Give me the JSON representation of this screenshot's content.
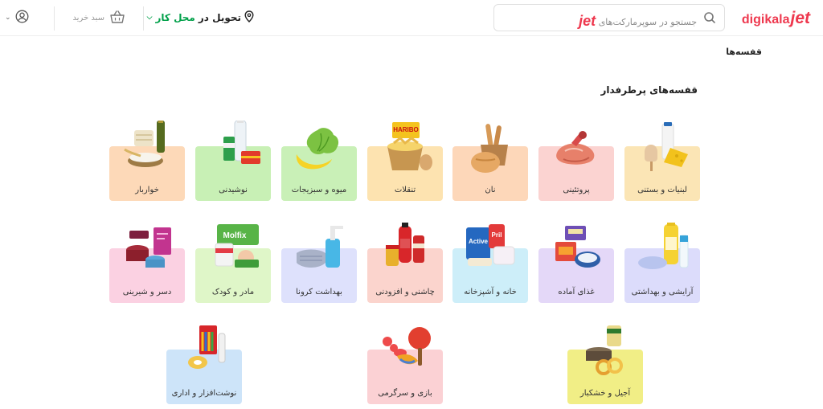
{
  "header": {
    "logo": {
      "brand": "digikala",
      "suffix": "jet"
    },
    "search": {
      "placeholder_prefix": "جستجو در سوپرمارکت‌های",
      "placeholder_brand": "jet"
    },
    "address": {
      "prefix": "تحویل در",
      "location": "محل کار"
    },
    "cart": {
      "label": "سبد خرید"
    }
  },
  "breadcrumb": "قفسه‌ها",
  "section_title": "قفسه‌های پرطرفدار",
  "categories": [
    {
      "label": "لبنیات و بستنی",
      "bg": "#fbe5b5"
    },
    {
      "label": "پروتئینی",
      "bg": "#fbd3d1"
    },
    {
      "label": "نان",
      "bg": "#fdd7b9"
    },
    {
      "label": "تنقلات",
      "bg": "#fde3b0"
    },
    {
      "label": "میوه و سبزیجات",
      "bg": "#c9f0b7"
    },
    {
      "label": "نوشیدنی",
      "bg": "#c8f0b5"
    },
    {
      "label": "خواربار",
      "bg": "#fdd9b8"
    },
    {
      "label": "آرایشی و بهداشتی",
      "bg": "#dcdcfb"
    },
    {
      "label": "غذای آماده",
      "bg": "#e4d8f8"
    },
    {
      "label": "خانه و آشپزخانه",
      "bg": "#cdeef9"
    },
    {
      "label": "چاشنی و افزودنی",
      "bg": "#fbd4cd"
    },
    {
      "label": "بهداشت کرونا",
      "bg": "#dee1fc"
    },
    {
      "label": "مادر و کودک",
      "bg": "#dff6c8"
    },
    {
      "label": "دسر و شیرینی",
      "bg": "#fbd1e2"
    },
    {
      "label": "آجیل و خشکبار",
      "bg": "#f1ee86"
    },
    {
      "label": "بازی و سرگرمی",
      "bg": "#fbd1d4"
    },
    {
      "label": "نوشت‌افزار و اداری",
      "bg": "#cde4f9"
    }
  ]
}
